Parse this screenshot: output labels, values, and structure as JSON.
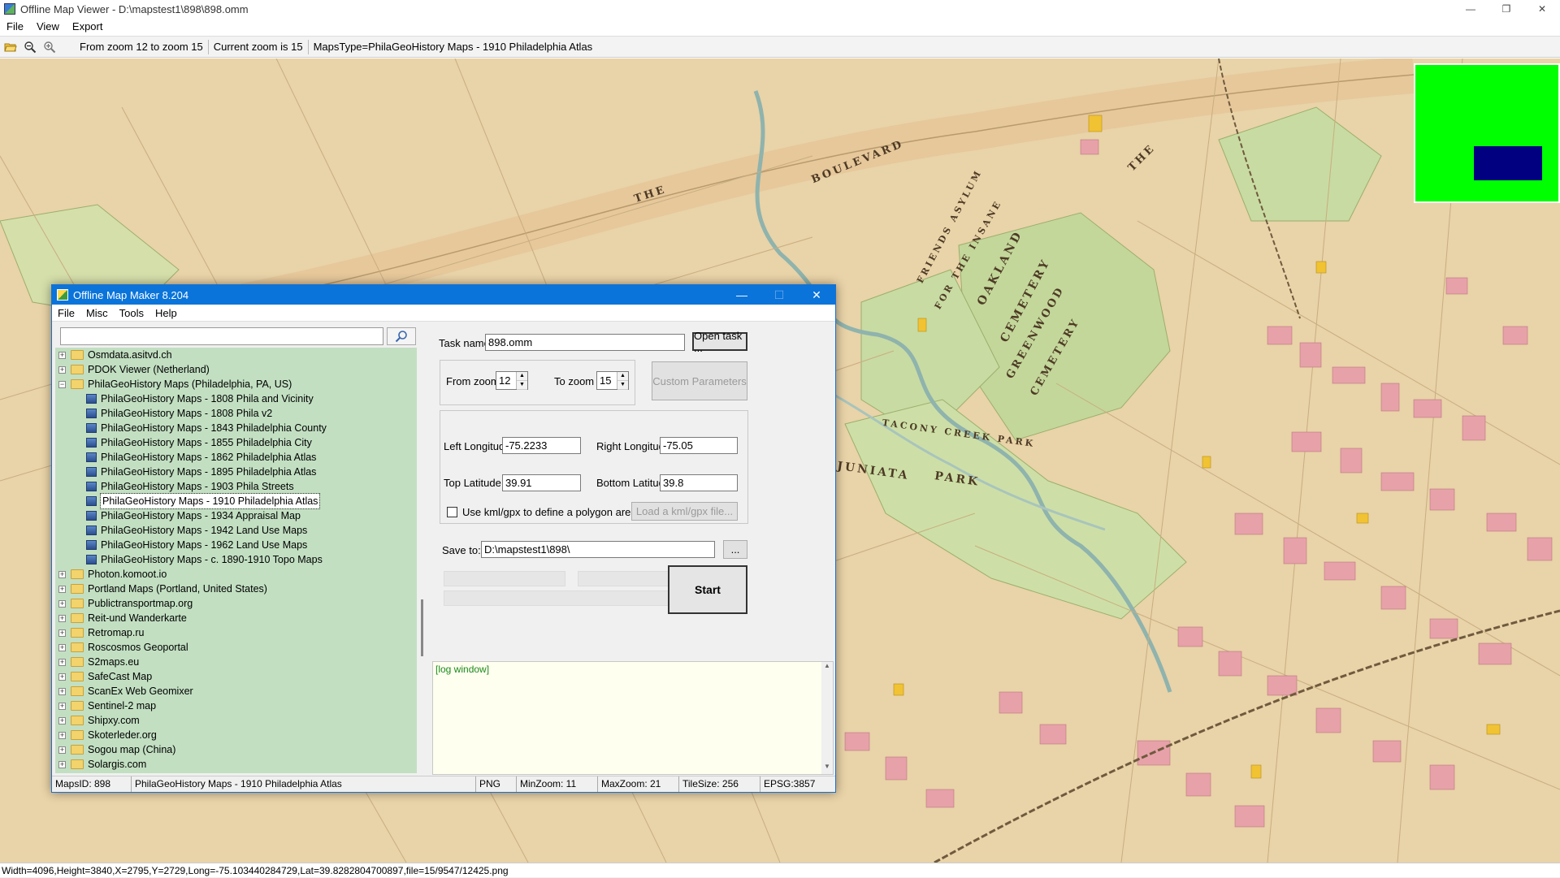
{
  "viewer": {
    "title": "Offline Map Viewer - D:\\mapstest1\\898\\898.omm",
    "window_buttons": [
      "—",
      "❐",
      "✕"
    ],
    "menu": [
      "File",
      "View",
      "Export"
    ],
    "toolbar": {
      "icons": [
        "open-folder-icon",
        "zoom-out-icon",
        "zoom-in-icon"
      ],
      "zoom_range": "From zoom 12 to zoom 15",
      "current_zoom": "Current zoom is 15",
      "maps_type": "MapsType=PhilaGeoHistory Maps - 1910 Philadelphia Atlas"
    },
    "status": "Width=4096,Height=3840,X=2795,Y=2729,Long=-75.103440284729,Lat=39.8282804700897,file=15/9547/12425.png"
  },
  "map": {
    "labels": [
      "BOULEVARD",
      "THE",
      "FRIENDS ASYLUM",
      "FOR THE INSANE",
      "OAKLAND",
      "CEMETERY",
      "GREENWOOD",
      "CEMETERY",
      "TACONY CREEK PARK",
      "JUNIATA",
      "PARK",
      "THE"
    ],
    "colors": {
      "paper": "#e9d3a8",
      "building_pink": "#e7a1a8",
      "park_green": "#c3d79a",
      "river": "#9fb9b0",
      "roads": "#dcc49a"
    }
  },
  "overview": {
    "bg": "#00ff00",
    "viewport": "#000080"
  },
  "dialog": {
    "title": "Offline Map Maker 8.204",
    "window_buttons": [
      "—",
      "☐",
      "✕"
    ],
    "menu": [
      "File",
      "Misc",
      "Tools",
      "Help"
    ],
    "search": {
      "value": "",
      "icon": "search-icon"
    },
    "tree": [
      {
        "label": "Osmdata.asitvd.ch",
        "level": 0,
        "expanded": false
      },
      {
        "label": "PDOK Viewer (Netherland)",
        "level": 0,
        "expanded": false
      },
      {
        "label": "PhilaGeoHistory Maps (Philadelphia, PA, US)",
        "level": 0,
        "expanded": true
      },
      {
        "label": "PhilaGeoHistory Maps - 1808 Phila and Vicinity",
        "level": 1
      },
      {
        "label": "PhilaGeoHistory Maps - 1808 Phila v2",
        "level": 1
      },
      {
        "label": "PhilaGeoHistory Maps - 1843 Philadelphia County",
        "level": 1
      },
      {
        "label": "PhilaGeoHistory Maps - 1855 Philadelphia City",
        "level": 1
      },
      {
        "label": "PhilaGeoHistory Maps - 1862 Philadelphia Atlas",
        "level": 1
      },
      {
        "label": "PhilaGeoHistory Maps - 1895 Philadelphia Atlas",
        "level": 1
      },
      {
        "label": "PhilaGeoHistory Maps - 1903 Phila Streets",
        "level": 1
      },
      {
        "label": "PhilaGeoHistory Maps - 1910 Philadelphia Atlas",
        "level": 1,
        "selected": true
      },
      {
        "label": "PhilaGeoHistory Maps - 1934 Appraisal Map",
        "level": 1
      },
      {
        "label": "PhilaGeoHistory Maps - 1942 Land Use Maps",
        "level": 1
      },
      {
        "label": "PhilaGeoHistory Maps - 1962 Land Use Maps",
        "level": 1
      },
      {
        "label": "PhilaGeoHistory Maps - c. 1890-1910 Topo Maps",
        "level": 1
      },
      {
        "label": "Photon.komoot.io",
        "level": 0,
        "expanded": false
      },
      {
        "label": "Portland Maps (Portland, United States)",
        "level": 0,
        "expanded": false
      },
      {
        "label": "Publictransportmap.org",
        "level": 0,
        "expanded": false
      },
      {
        "label": "Reit-und Wanderkarte",
        "level": 0,
        "expanded": false
      },
      {
        "label": "Retromap.ru",
        "level": 0,
        "expanded": false
      },
      {
        "label": "Roscosmos Geoportal",
        "level": 0,
        "expanded": false
      },
      {
        "label": "S2maps.eu",
        "level": 0,
        "expanded": false
      },
      {
        "label": "SafeCast Map",
        "level": 0,
        "expanded": false
      },
      {
        "label": "ScanEx Web Geomixer",
        "level": 0,
        "expanded": false
      },
      {
        "label": "Sentinel-2 map",
        "level": 0,
        "expanded": false
      },
      {
        "label": "Shipxy.com",
        "level": 0,
        "expanded": false
      },
      {
        "label": "Skoterleder.org",
        "level": 0,
        "expanded": false
      },
      {
        "label": "Sogou map (China)",
        "level": 0,
        "expanded": false
      },
      {
        "label": "Solargis.com",
        "level": 0,
        "expanded": false
      }
    ],
    "task": {
      "label": "Task name",
      "value": "898.omm",
      "open_button": "Open task ..."
    },
    "zoom": {
      "from_label": "From zoom",
      "from_value": "12",
      "to_label": "To zoom",
      "to_value": "15",
      "custom_button": "Custom Parameters"
    },
    "bounds": {
      "left_lon_label": "Left Longitude",
      "left_lon": "-75.2233",
      "right_lon_label": "Right Longitude",
      "right_lon": "-75.05",
      "top_lat_label": "Top Latitude",
      "top_lat": "39.91",
      "bottom_lat_label": "Bottom Latitude",
      "bottom_lat": "39.8",
      "kml_check_label": "Use kml/gpx to define a polygon area",
      "kml_checked": false,
      "kml_button": "Load a kml/gpx file..."
    },
    "save": {
      "label": "Save to:",
      "value": "D:\\mapstest1\\898\\",
      "browse_button": "..."
    },
    "start_button": "Start",
    "log": "[log window]",
    "status": {
      "maps_id": "MapsID: 898",
      "maps_name": "PhilaGeoHistory Maps - 1910 Philadelphia Atlas",
      "format": "PNG",
      "min_zoom": "MinZoom: 11",
      "max_zoom": "MaxZoom: 21",
      "tile_size": "TileSize: 256",
      "epsg": "EPSG:3857"
    }
  }
}
